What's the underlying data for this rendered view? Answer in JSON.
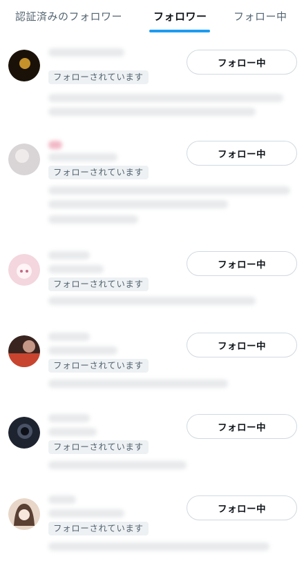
{
  "tabs": [
    {
      "label": "認証済みのフォロワー",
      "active": false
    },
    {
      "label": "フォロワー",
      "active": true
    },
    {
      "label": "フォロー中",
      "active": false
    }
  ],
  "accent_color": "#1d9bf0",
  "rows": [
    {
      "badge": "フォローされています",
      "button": "フォロー中",
      "avatar_colors": [
        "#1a1208",
        "#d8a030"
      ]
    },
    {
      "badge": "フォローされています",
      "button": "フォロー中",
      "avatar_colors": [
        "#d9d5d6",
        "#f2efef"
      ]
    },
    {
      "badge": "フォローされています",
      "button": "フォロー中",
      "avatar_colors": [
        "#f3d6de",
        "#fff4f6"
      ]
    },
    {
      "badge": "フォローされています",
      "button": "フォロー中",
      "avatar_colors": [
        "#c9442e",
        "#3a2420"
      ]
    },
    {
      "badge": "フォローされています",
      "button": "フォロー中",
      "avatar_colors": [
        "#1e2330",
        "#4a5266"
      ]
    },
    {
      "badge": "フォローされています",
      "button": "フォロー中",
      "avatar_colors": [
        "#5a3f33",
        "#e8d6c8"
      ]
    }
  ]
}
